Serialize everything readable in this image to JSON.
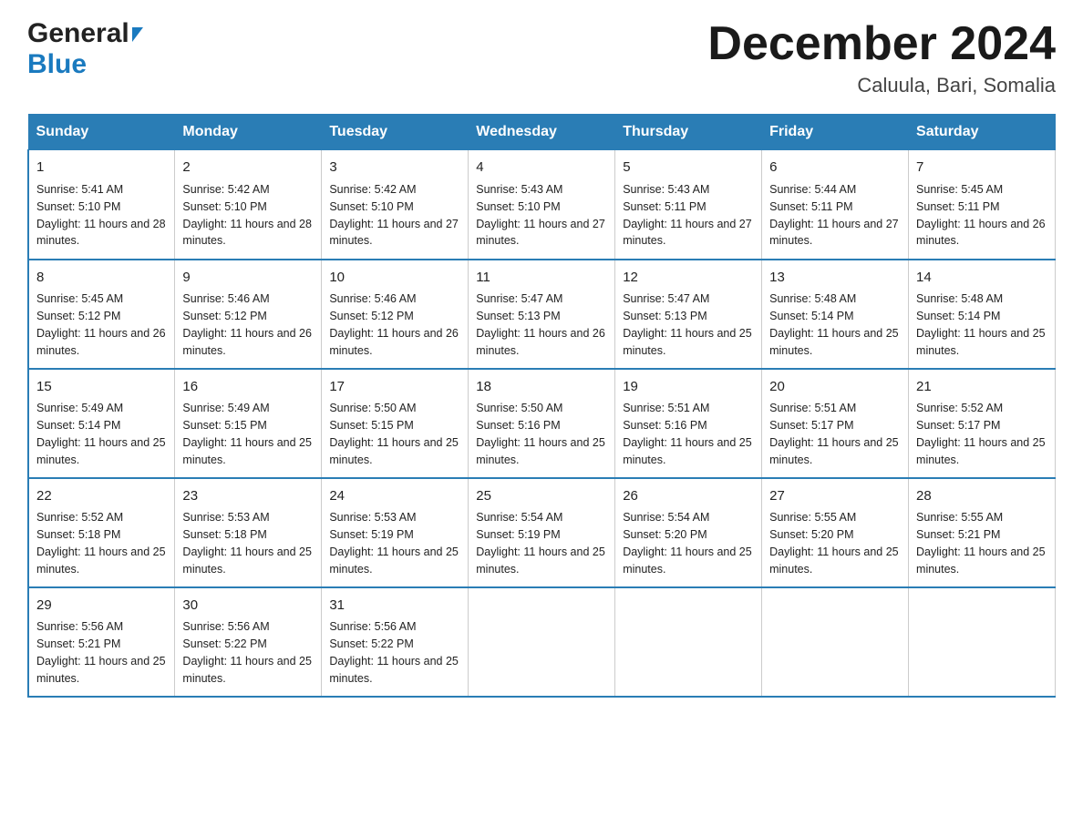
{
  "header": {
    "title": "December 2024",
    "location": "Caluula, Bari, Somalia",
    "logo_general": "General",
    "logo_blue": "Blue"
  },
  "weekdays": [
    "Sunday",
    "Monday",
    "Tuesday",
    "Wednesday",
    "Thursday",
    "Friday",
    "Saturday"
  ],
  "weeks": [
    [
      {
        "day": "1",
        "sunrise": "5:41 AM",
        "sunset": "5:10 PM",
        "daylight": "11 hours and 28 minutes."
      },
      {
        "day": "2",
        "sunrise": "5:42 AM",
        "sunset": "5:10 PM",
        "daylight": "11 hours and 28 minutes."
      },
      {
        "day": "3",
        "sunrise": "5:42 AM",
        "sunset": "5:10 PM",
        "daylight": "11 hours and 27 minutes."
      },
      {
        "day": "4",
        "sunrise": "5:43 AM",
        "sunset": "5:10 PM",
        "daylight": "11 hours and 27 minutes."
      },
      {
        "day": "5",
        "sunrise": "5:43 AM",
        "sunset": "5:11 PM",
        "daylight": "11 hours and 27 minutes."
      },
      {
        "day": "6",
        "sunrise": "5:44 AM",
        "sunset": "5:11 PM",
        "daylight": "11 hours and 27 minutes."
      },
      {
        "day": "7",
        "sunrise": "5:45 AM",
        "sunset": "5:11 PM",
        "daylight": "11 hours and 26 minutes."
      }
    ],
    [
      {
        "day": "8",
        "sunrise": "5:45 AM",
        "sunset": "5:12 PM",
        "daylight": "11 hours and 26 minutes."
      },
      {
        "day": "9",
        "sunrise": "5:46 AM",
        "sunset": "5:12 PM",
        "daylight": "11 hours and 26 minutes."
      },
      {
        "day": "10",
        "sunrise": "5:46 AM",
        "sunset": "5:12 PM",
        "daylight": "11 hours and 26 minutes."
      },
      {
        "day": "11",
        "sunrise": "5:47 AM",
        "sunset": "5:13 PM",
        "daylight": "11 hours and 26 minutes."
      },
      {
        "day": "12",
        "sunrise": "5:47 AM",
        "sunset": "5:13 PM",
        "daylight": "11 hours and 25 minutes."
      },
      {
        "day": "13",
        "sunrise": "5:48 AM",
        "sunset": "5:14 PM",
        "daylight": "11 hours and 25 minutes."
      },
      {
        "day": "14",
        "sunrise": "5:48 AM",
        "sunset": "5:14 PM",
        "daylight": "11 hours and 25 minutes."
      }
    ],
    [
      {
        "day": "15",
        "sunrise": "5:49 AM",
        "sunset": "5:14 PM",
        "daylight": "11 hours and 25 minutes."
      },
      {
        "day": "16",
        "sunrise": "5:49 AM",
        "sunset": "5:15 PM",
        "daylight": "11 hours and 25 minutes."
      },
      {
        "day": "17",
        "sunrise": "5:50 AM",
        "sunset": "5:15 PM",
        "daylight": "11 hours and 25 minutes."
      },
      {
        "day": "18",
        "sunrise": "5:50 AM",
        "sunset": "5:16 PM",
        "daylight": "11 hours and 25 minutes."
      },
      {
        "day": "19",
        "sunrise": "5:51 AM",
        "sunset": "5:16 PM",
        "daylight": "11 hours and 25 minutes."
      },
      {
        "day": "20",
        "sunrise": "5:51 AM",
        "sunset": "5:17 PM",
        "daylight": "11 hours and 25 minutes."
      },
      {
        "day": "21",
        "sunrise": "5:52 AM",
        "sunset": "5:17 PM",
        "daylight": "11 hours and 25 minutes."
      }
    ],
    [
      {
        "day": "22",
        "sunrise": "5:52 AM",
        "sunset": "5:18 PM",
        "daylight": "11 hours and 25 minutes."
      },
      {
        "day": "23",
        "sunrise": "5:53 AM",
        "sunset": "5:18 PM",
        "daylight": "11 hours and 25 minutes."
      },
      {
        "day": "24",
        "sunrise": "5:53 AM",
        "sunset": "5:19 PM",
        "daylight": "11 hours and 25 minutes."
      },
      {
        "day": "25",
        "sunrise": "5:54 AM",
        "sunset": "5:19 PM",
        "daylight": "11 hours and 25 minutes."
      },
      {
        "day": "26",
        "sunrise": "5:54 AM",
        "sunset": "5:20 PM",
        "daylight": "11 hours and 25 minutes."
      },
      {
        "day": "27",
        "sunrise": "5:55 AM",
        "sunset": "5:20 PM",
        "daylight": "11 hours and 25 minutes."
      },
      {
        "day": "28",
        "sunrise": "5:55 AM",
        "sunset": "5:21 PM",
        "daylight": "11 hours and 25 minutes."
      }
    ],
    [
      {
        "day": "29",
        "sunrise": "5:56 AM",
        "sunset": "5:21 PM",
        "daylight": "11 hours and 25 minutes."
      },
      {
        "day": "30",
        "sunrise": "5:56 AM",
        "sunset": "5:22 PM",
        "daylight": "11 hours and 25 minutes."
      },
      {
        "day": "31",
        "sunrise": "5:56 AM",
        "sunset": "5:22 PM",
        "daylight": "11 hours and 25 minutes."
      },
      null,
      null,
      null,
      null
    ]
  ]
}
